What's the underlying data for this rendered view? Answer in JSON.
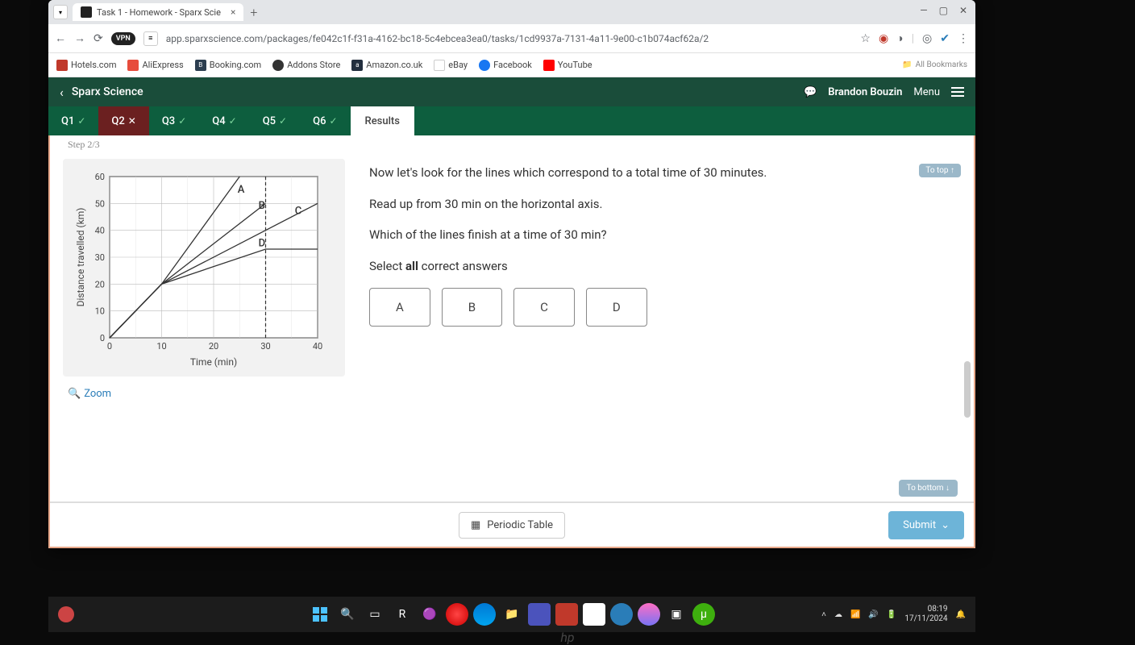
{
  "browser": {
    "tab_title": "Task 1 - Homework - Sparx Scie",
    "url": "app.sparxscience.com/packages/fe042c1f-f31a-4162-bc18-5c4ebcea3ea0/tasks/1cd9937a-7131-4a11-9e00-c1b074acf62a/2",
    "vpn": "VPN"
  },
  "bookmarks": [
    {
      "label": "Hotels.com",
      "color": "#c0392b"
    },
    {
      "label": "AliExpress",
      "color": "#e74c3c"
    },
    {
      "label": "Booking.com",
      "color": "#2c3e50"
    },
    {
      "label": "Addons Store",
      "color": "#333"
    },
    {
      "label": "Amazon.co.uk",
      "color": "#333"
    },
    {
      "label": "eBay",
      "color": "#e74c3c"
    },
    {
      "label": "Facebook",
      "color": "#1877f2"
    },
    {
      "label": "YouTube",
      "color": "#ff0000"
    }
  ],
  "all_bookmarks": "All Bookmarks",
  "app": {
    "title": "Sparx Science",
    "user": "Brandon Bouzin",
    "menu": "Menu"
  },
  "tabs": {
    "q1": "Q1",
    "q2": "Q2",
    "q3": "Q3",
    "q4": "Q4",
    "q5": "Q5",
    "q6": "Q6",
    "results": "Results"
  },
  "step": "Step 2/3",
  "question": {
    "line1": "Now let's look for the lines which correspond to a total time of 30 minutes.",
    "line2": "Read up from 30 min on the horizontal axis.",
    "line3": "Which of the lines finish at a time of 30 min?",
    "select": "Select all correct answers",
    "to_top": "To top ↑",
    "to_bottom": "To bottom ↓",
    "options": {
      "a": "A",
      "b": "B",
      "c": "C",
      "d": "D"
    }
  },
  "zoom": "Zoom",
  "periodic": "Periodic Table",
  "submit": "Submit",
  "clock": {
    "time": "08:19",
    "date": "17/11/2024"
  },
  "chart_data": {
    "type": "line",
    "title": "",
    "xlabel": "Time (min)",
    "ylabel": "Distance travelled (km)",
    "xlim": [
      0,
      40
    ],
    "ylim": [
      0,
      60
    ],
    "xticks": [
      0,
      10,
      20,
      30,
      40
    ],
    "yticks": [
      0,
      10,
      20,
      30,
      40,
      50,
      60
    ],
    "highlight_x": 30,
    "series": [
      {
        "name": "A",
        "x": [
          0,
          10,
          25
        ],
        "y": [
          0,
          20,
          60
        ]
      },
      {
        "name": "B",
        "x": [
          0,
          10,
          30
        ],
        "y": [
          0,
          20,
          50
        ]
      },
      {
        "name": "C",
        "x": [
          0,
          10,
          40
        ],
        "y": [
          0,
          20,
          50
        ]
      },
      {
        "name": "D",
        "x": [
          0,
          10,
          30,
          40
        ],
        "y": [
          0,
          20,
          33,
          33
        ]
      }
    ]
  }
}
